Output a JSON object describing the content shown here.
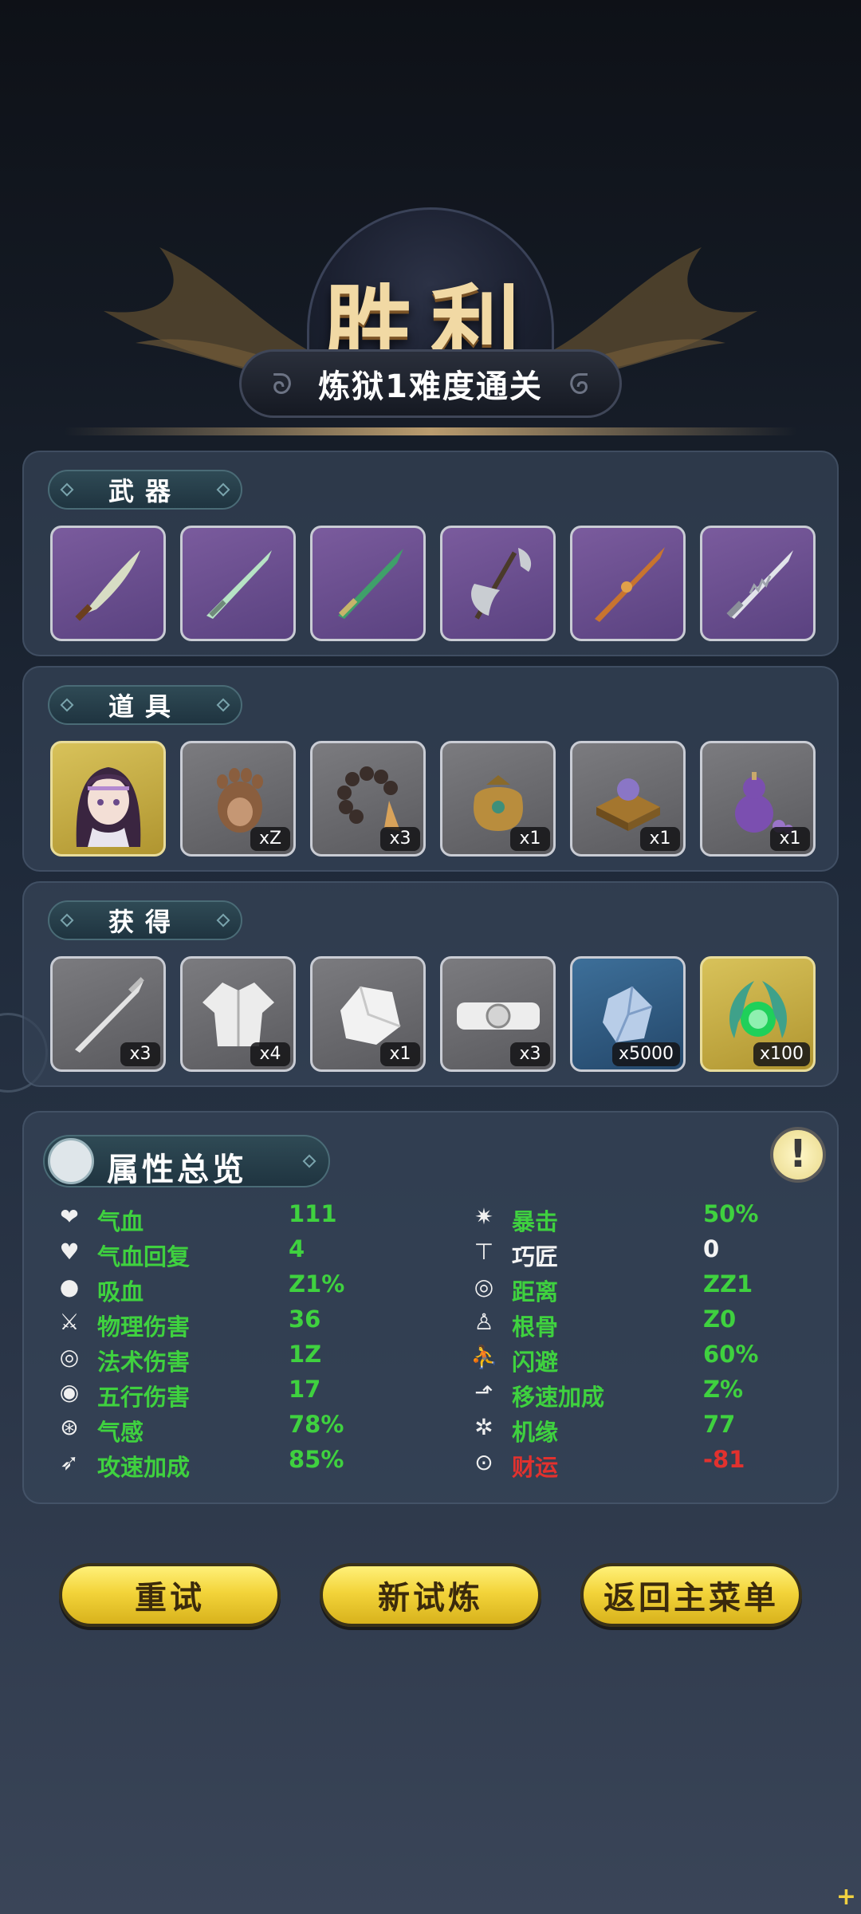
{
  "header": {
    "title": "胜利",
    "subtitle": "炼狱1难度通关"
  },
  "weapons": {
    "label": "武器",
    "items": [
      {
        "icon": "curved-blade-icon"
      },
      {
        "icon": "jade-sword-icon"
      },
      {
        "icon": "green-sword-icon"
      },
      {
        "icon": "battle-axe-icon"
      },
      {
        "icon": "bronze-spear-icon"
      },
      {
        "icon": "serrated-blade-icon"
      }
    ]
  },
  "props": {
    "label": "道具",
    "items": [
      {
        "icon": "character-portrait-icon",
        "count": ""
      },
      {
        "icon": "bear-paw-icon",
        "count": "xZ"
      },
      {
        "icon": "prayer-beads-icon",
        "count": "x3"
      },
      {
        "icon": "money-pouch-icon",
        "count": "x1"
      },
      {
        "icon": "orb-pedestal-icon",
        "count": "x1"
      },
      {
        "icon": "purple-gourd-icon",
        "count": "x1"
      }
    ]
  },
  "obtained": {
    "label": "获得",
    "items": [
      {
        "icon": "steel-sword-icon",
        "count": "x3"
      },
      {
        "icon": "robe-icon",
        "count": "x4"
      },
      {
        "icon": "ore-icon",
        "count": "x1"
      },
      {
        "icon": "belt-icon",
        "count": "x3"
      },
      {
        "icon": "crystal-icon",
        "count": "x5000"
      },
      {
        "icon": "green-flame-icon",
        "count": "x100"
      }
    ]
  },
  "attributes": {
    "title": "属性总览",
    "info_icon": "!",
    "left": [
      {
        "icon": "heart-icon",
        "label": "气血",
        "value": "111"
      },
      {
        "icon": "heart-regen-icon",
        "label": "气血回复",
        "value": "4"
      },
      {
        "icon": "blood-drop-icon",
        "label": "吸血",
        "value": "Z1%"
      },
      {
        "icon": "sword-icon",
        "label": "物理伤害",
        "value": "36"
      },
      {
        "icon": "spiral-icon",
        "label": "法术伤害",
        "value": "1Z"
      },
      {
        "icon": "elements-icon",
        "label": "五行伤害",
        "value": "17"
      },
      {
        "icon": "qi-icon",
        "label": "气感",
        "value": "78%"
      },
      {
        "icon": "attack-speed-icon",
        "label": "攻速加成",
        "value": "85%"
      }
    ],
    "right": [
      {
        "icon": "critical-icon",
        "label": "暴击",
        "value": "50%"
      },
      {
        "icon": "hammer-icon",
        "label": "巧匠",
        "value": "0",
        "white": true
      },
      {
        "icon": "range-icon",
        "label": "距离",
        "value": "ZZ1"
      },
      {
        "icon": "meditation-icon",
        "label": "根骨",
        "value": "Z0"
      },
      {
        "icon": "dodge-icon",
        "label": "闪避",
        "value": "60%"
      },
      {
        "icon": "boot-icon",
        "label": "移速加成",
        "value": "Z%"
      },
      {
        "icon": "fortune-icon",
        "label": "机缘",
        "value": "77"
      },
      {
        "icon": "coin-icon",
        "label": "财运",
        "value": "-81",
        "red": true
      }
    ]
  },
  "buttons": {
    "retry": "重试",
    "new_trial": "新试炼",
    "main_menu": "返回主菜单"
  },
  "colors": {
    "stat_green": "#3fd13f",
    "stat_red": "#e2312e",
    "button_gold": "#f3d43a",
    "title_gold": "#f1d9a4"
  }
}
